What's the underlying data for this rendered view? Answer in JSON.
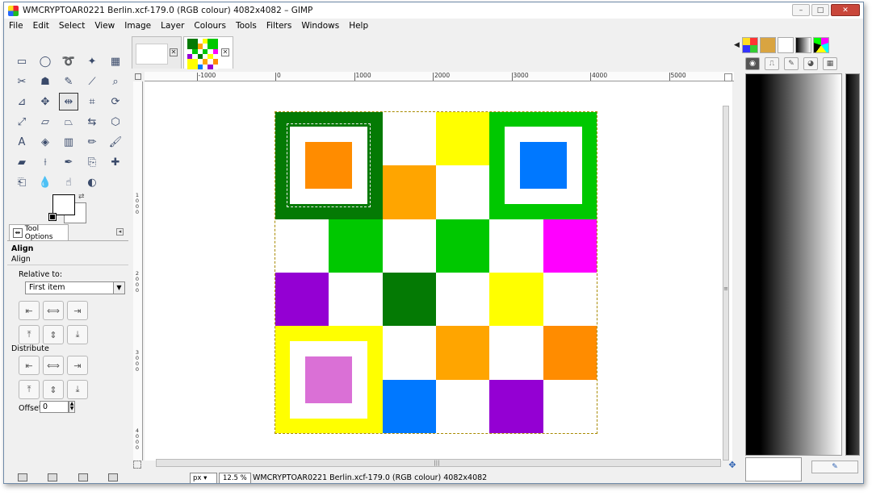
{
  "window": {
    "title": "WMCRYPTOAR0221 Berlin.xcf-179.0 (RGB colour) 4082x4082 – GIMP",
    "buttons": {
      "minimize": "–",
      "maximize": "□",
      "close": "✕"
    }
  },
  "menu": [
    "File",
    "Edit",
    "Select",
    "View",
    "Image",
    "Layer",
    "Colours",
    "Tools",
    "Filters",
    "Windows",
    "Help"
  ],
  "toolbox": {
    "tools": [
      {
        "name": "rect-select-icon",
        "glyph": "▭"
      },
      {
        "name": "ellipse-select-icon",
        "glyph": "◯"
      },
      {
        "name": "free-select-icon",
        "glyph": "➰"
      },
      {
        "name": "fuzzy-select-icon",
        "glyph": "✦"
      },
      {
        "name": "color-select-icon",
        "glyph": "▦"
      },
      {
        "name": "scissors-icon",
        "glyph": "✂"
      },
      {
        "name": "foreground-select-icon",
        "glyph": "☗"
      },
      {
        "name": "paths-icon",
        "glyph": "✎"
      },
      {
        "name": "color-picker-icon",
        "glyph": "⟋"
      },
      {
        "name": "zoom-icon",
        "glyph": "⌕"
      },
      {
        "name": "measure-icon",
        "glyph": "⊿"
      },
      {
        "name": "move-icon",
        "glyph": "✥"
      },
      {
        "name": "align-icon",
        "glyph": "⇹"
      },
      {
        "name": "crop-icon",
        "glyph": "⌗"
      },
      {
        "name": "rotate-icon",
        "glyph": "⟳"
      },
      {
        "name": "scale-icon",
        "glyph": "⤢"
      },
      {
        "name": "shear-icon",
        "glyph": "▱"
      },
      {
        "name": "perspective-icon",
        "glyph": "⏢"
      },
      {
        "name": "flip-icon",
        "glyph": "⇆"
      },
      {
        "name": "cage-icon",
        "glyph": "⬡"
      },
      {
        "name": "text-icon",
        "glyph": "A"
      },
      {
        "name": "bucket-fill-icon",
        "glyph": "◈"
      },
      {
        "name": "blend-icon",
        "glyph": "▥"
      },
      {
        "name": "pencil-icon",
        "glyph": "✏"
      },
      {
        "name": "paintbrush-icon",
        "glyph": "🖌"
      },
      {
        "name": "eraser-icon",
        "glyph": "▰"
      },
      {
        "name": "airbrush-icon",
        "glyph": "⟊"
      },
      {
        "name": "ink-icon",
        "glyph": "✒"
      },
      {
        "name": "clone-icon",
        "glyph": "⎘"
      },
      {
        "name": "heal-icon",
        "glyph": "✚"
      },
      {
        "name": "perspective-clone-icon",
        "glyph": "⎗"
      },
      {
        "name": "blur-icon",
        "glyph": "💧"
      },
      {
        "name": "smudge-icon",
        "glyph": "☝"
      },
      {
        "name": "dodge-burn-icon",
        "glyph": "◐"
      }
    ]
  },
  "tool_options": {
    "tab_label": "Tool Options",
    "heading": "Align",
    "subheading": "Align",
    "relative_label": "Relative to:",
    "relative_value": "First item",
    "distribute_label": "Distribute",
    "offset_label": "Offset:",
    "offset_value": "0"
  },
  "ruler": {
    "h_labels": [
      "-1000",
      "0",
      "1000",
      "2000",
      "3000",
      "4000",
      "5000"
    ],
    "v_labels": [
      "1000",
      "2000",
      "3000",
      "4000"
    ]
  },
  "image": {
    "colors": {
      "dark_green": "#047a04",
      "green": "#00c800",
      "yellow": "#ffff00",
      "orange": "#ffa500",
      "dark_orange": "#ff8c00",
      "blue": "#0078ff",
      "magenta": "#ff00ff",
      "purple": "#9400d3",
      "orchid": "#da70d6",
      "white": "#ffffff"
    },
    "grid": [
      [
        "dark_green",
        "dark_green",
        "white",
        "yellow",
        "green",
        "green"
      ],
      [
        "dark_green",
        "dark_green",
        "orange",
        "white",
        "green",
        "green"
      ],
      [
        "white",
        "green",
        "white",
        "green",
        "white",
        "magenta"
      ],
      [
        "purple",
        "white",
        "dark_green",
        "white",
        "yellow",
        "white"
      ],
      [
        "yellow",
        "yellow",
        "white",
        "orange",
        "white",
        "dark_orange"
      ],
      [
        "yellow",
        "yellow",
        "blue",
        "white",
        "purple",
        "white"
      ]
    ]
  },
  "statusbar": {
    "unit": "px",
    "zoom": "12.5 %",
    "text": "WMCRYPTOAR0221 Berlin.xcf-179.0 (RGB colour) 4082x4082"
  }
}
